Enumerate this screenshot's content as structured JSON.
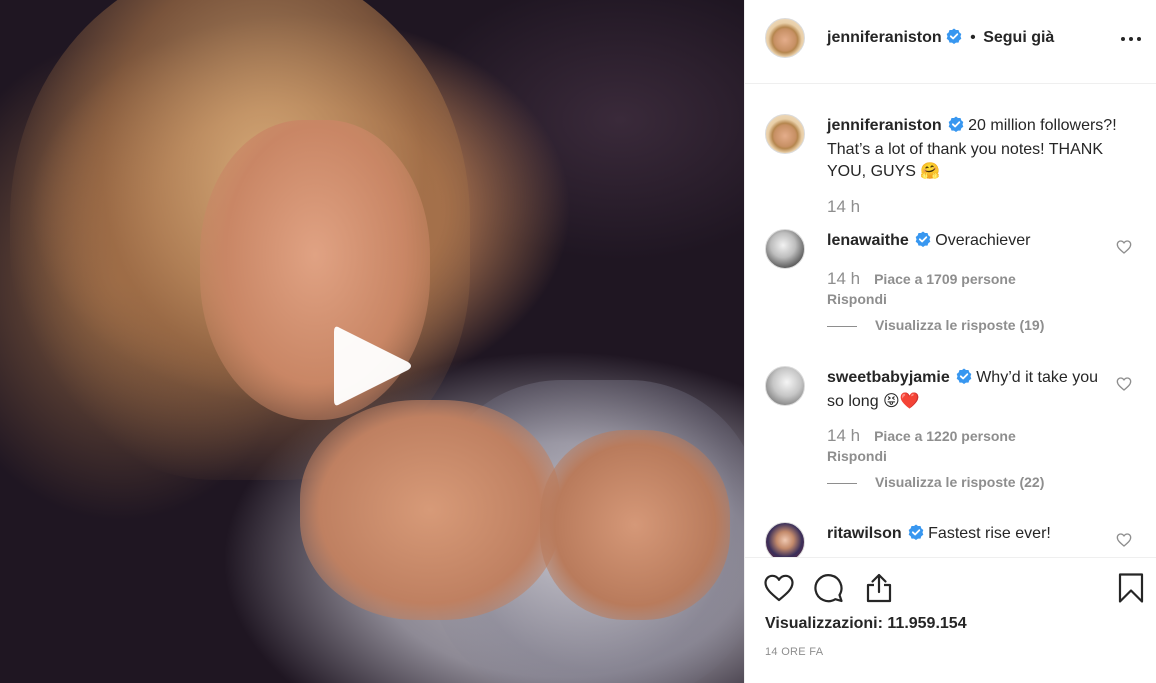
{
  "media": {
    "type": "video",
    "play_icon": "play-icon"
  },
  "header": {
    "username": "jenniferaniston",
    "verified_icon": "verified-badge-icon",
    "separator": "•",
    "follow_label": "Segui già",
    "more_icon": "more-options-icon"
  },
  "caption": {
    "username": "jenniferaniston",
    "text": "20 million followers?! That’s a lot of thank you notes! THANK YOU, GUYS 🤗",
    "time": "14 h"
  },
  "comments": [
    {
      "username": "lenawaithe",
      "text": "Overachiever",
      "time": "14 h",
      "likes": "Piace a 1709 persone",
      "reply_label": "Rispondi",
      "view_replies": "Visualizza le risposte (19)"
    },
    {
      "username": "sweetbabyjamie",
      "text": "Why’d it take you so long 😝❤️",
      "time": "14 h",
      "likes": "Piace a 1220 persone",
      "reply_label": "Rispondi",
      "view_replies": "Visualizza le risposte (22)"
    },
    {
      "username": "ritawilson",
      "text": "Fastest rise ever!"
    }
  ],
  "actions": {
    "like_icon": "heart-icon",
    "comment_icon": "comment-icon",
    "share_icon": "share-icon",
    "save_icon": "bookmark-icon",
    "views": "Visualizzazioni: 11.959.154",
    "posted": "14 ORE FA"
  },
  "colors": {
    "text": "#262626",
    "muted": "#8e8e8e",
    "verified": "#3897f0",
    "border": "#efefef"
  }
}
